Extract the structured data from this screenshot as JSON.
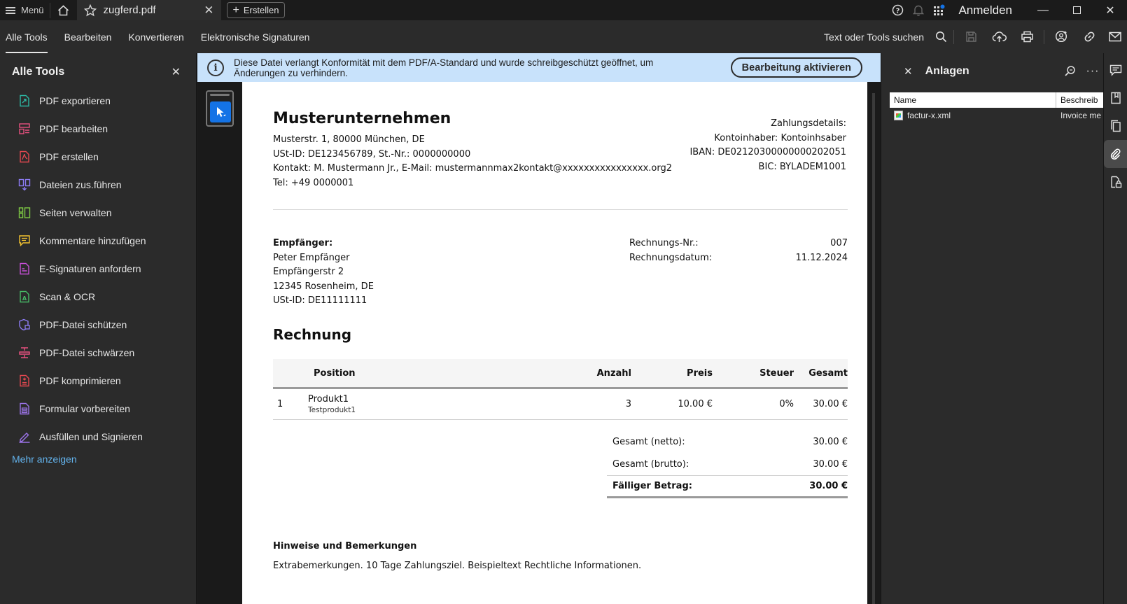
{
  "titlebar": {
    "menu_label": "Menü",
    "tab_title": "zugferd.pdf",
    "create_label": "Erstellen",
    "login_label": "Anmelden"
  },
  "toolbar": {
    "tabs": [
      "Alle Tools",
      "Bearbeiten",
      "Konvertieren",
      "Elektronische Signaturen"
    ],
    "active_tab": "Alle Tools",
    "search_label": "Text oder Tools suchen"
  },
  "sidebar": {
    "title": "Alle Tools",
    "items": [
      {
        "label": "PDF exportieren",
        "icon": "export-pdf-icon",
        "color": "#2db7a3"
      },
      {
        "label": "PDF bearbeiten",
        "icon": "edit-pdf-icon",
        "color": "#e8517f"
      },
      {
        "label": "PDF erstellen",
        "icon": "create-pdf-icon",
        "color": "#e34850"
      },
      {
        "label": "Dateien zus.führen",
        "icon": "combine-files-icon",
        "color": "#8d7cf5"
      },
      {
        "label": "Seiten verwalten",
        "icon": "organize-pages-icon",
        "color": "#7ec944"
      },
      {
        "label": "Kommentare hinzufügen",
        "icon": "comment-icon",
        "color": "#f2c230"
      },
      {
        "label": "E-Signaturen anfordern",
        "icon": "request-esign-icon",
        "color": "#c84fd8"
      },
      {
        "label": "Scan & OCR",
        "icon": "scan-ocr-icon",
        "color": "#47b865"
      },
      {
        "label": "PDF-Datei schützen",
        "icon": "protect-pdf-icon",
        "color": "#8d7cf5"
      },
      {
        "label": "PDF-Datei schwärzen",
        "icon": "redact-pdf-icon",
        "color": "#e8517f"
      },
      {
        "label": "PDF komprimieren",
        "icon": "compress-pdf-icon",
        "color": "#e34850"
      },
      {
        "label": "Formular vorbereiten",
        "icon": "prepare-form-icon",
        "color": "#9b73e8"
      },
      {
        "label": "Ausfüllen und Signieren",
        "icon": "fill-sign-icon",
        "color": "#9b73e8"
      }
    ],
    "more_label": "Mehr anzeigen"
  },
  "banner": {
    "message": "Diese Datei verlangt Konformität mit dem PDF/A-Standard und wurde schreibgeschützt geöffnet, um Änderungen zu verhindern.",
    "button_label": "Bearbeitung aktivieren"
  },
  "invoice": {
    "company": "Musterunternehmen",
    "address_lines": [
      "Musterstr. 1, 80000 München, DE",
      "USt-ID: DE123456789, St.-Nr.: 0000000000",
      "Kontakt: M. Mustermann Jr., E-Mail: mustermannmax2kontakt@xxxxxxxxxxxxxxxx.org2",
      "Tel: +49 0000001"
    ],
    "payment_lines": [
      "Zahlungsdetails:",
      "Kontoinhaber: Kontoinhsaber",
      "IBAN: DE02120300000000202051",
      "BIC: BYLADEM1001"
    ],
    "recipient_label": "Empfänger:",
    "recipient_lines": [
      "Peter Empfänger",
      "Empfängerstr 2",
      "12345 Rosenheim, DE",
      "USt-ID: DE11111111"
    ],
    "invoice_no_label": "Rechnungs-Nr.:",
    "invoice_no": "007",
    "invoice_date_label": "Rechnungsdatum:",
    "invoice_date": "11.12.2024",
    "heading": "Rechnung",
    "columns": {
      "position": "Position",
      "qty": "Anzahl",
      "price": "Preis",
      "tax": "Steuer",
      "total": "Gesamt"
    },
    "rows": [
      {
        "no": "1",
        "name": "Produkt1",
        "desc": "Testprodukt1",
        "qty": "3",
        "price": "10.00 €",
        "tax": "0%",
        "total": "30.00 €"
      }
    ],
    "totals": [
      {
        "label": "Gesamt (netto):",
        "value": "30.00 €"
      },
      {
        "label": "Gesamt (brutto):",
        "value": "30.00 €"
      }
    ],
    "due_label": "Fälliger Betrag:",
    "due_value": "30.00 €",
    "notes_heading": "Hinweise und Bemerkungen",
    "notes_text": "Extrabemerkungen. 10 Tage Zahlungsziel. Beispieltext Rechtliche Informationen."
  },
  "attachments": {
    "title": "Anlagen",
    "col_name": "Name",
    "col_desc": "Beschreib",
    "files": [
      {
        "name": "factur-x.xml",
        "desc": "Invoice me"
      }
    ]
  }
}
